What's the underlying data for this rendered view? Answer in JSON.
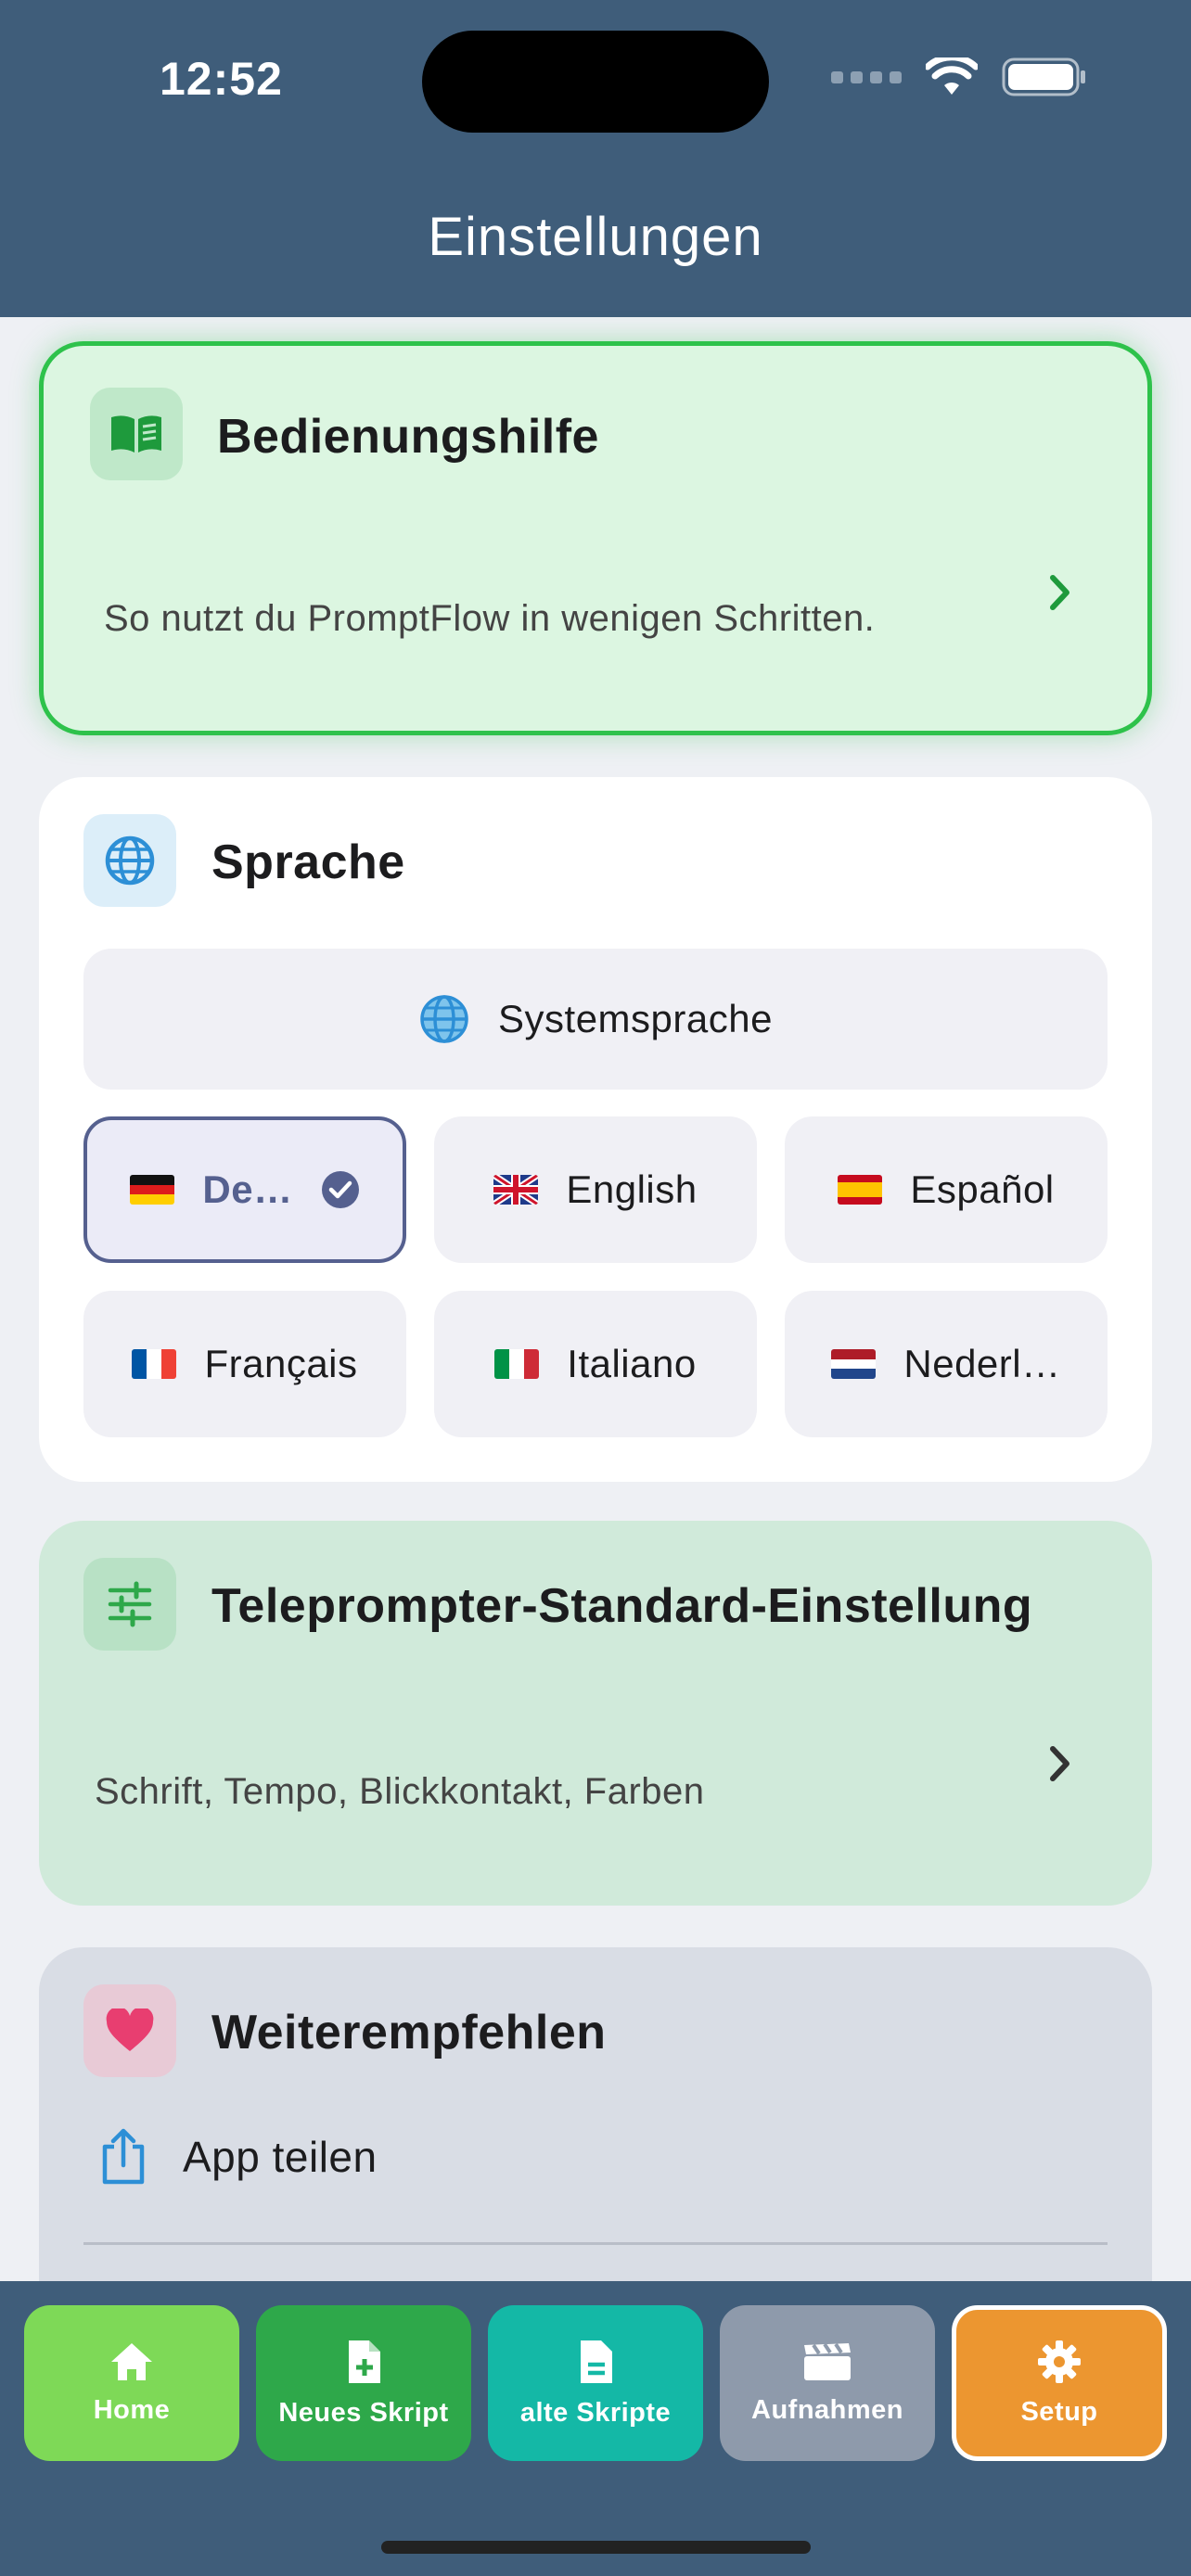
{
  "status": {
    "time": "12:52"
  },
  "header": {
    "title": "Einstellungen"
  },
  "help": {
    "title": "Bedienungshilfe",
    "subtitle": "So nutzt du PromptFlow in wenigen Schritten."
  },
  "language": {
    "title": "Sprache",
    "system_label": "Systemsprache",
    "options": [
      {
        "label": "De…",
        "selected": true
      },
      {
        "label": "English"
      },
      {
        "label": "Español"
      },
      {
        "label": "Français"
      },
      {
        "label": "Italiano"
      },
      {
        "label": "Nederl…"
      }
    ]
  },
  "teleprompter": {
    "title": "Teleprompter-Standard-Einstellung",
    "subtitle": "Schrift, Tempo, Blickkontakt, Farben"
  },
  "share": {
    "title": "Weiterempfehlen",
    "app_share_label": "App teilen"
  },
  "tabs": [
    {
      "label": "Home",
      "icon": "home-icon",
      "color": "#7ed957"
    },
    {
      "label": "Neues Skript",
      "icon": "new-file-icon",
      "color": "#2ea84a"
    },
    {
      "label": "alte Skripte",
      "icon": "document-icon",
      "color": "#14b8a6"
    },
    {
      "label": "Aufnahmen",
      "icon": "clapperboard-icon",
      "color": "#8e9aab"
    },
    {
      "label": "Setup",
      "icon": "gear-icon",
      "color": "#ec9630",
      "active": true
    }
  ],
  "colors": {
    "header_bg": "#3f5d7a",
    "help_border": "#2ec24b",
    "selected_language": "#55608f"
  }
}
